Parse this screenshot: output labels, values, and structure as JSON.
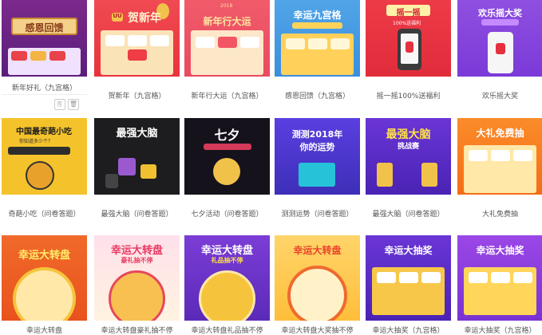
{
  "templates": [
    {
      "caption": "新年好礼（九宫格）",
      "headline": "感恩回馈"
    },
    {
      "caption": "贺新年（九宫格）",
      "headline": "贺新年",
      "badge": "UU"
    },
    {
      "caption": "新年行大运（九宫格）",
      "headline": "新年行大运",
      "tag": "2018"
    },
    {
      "caption": "感恩回馈（九宫格）",
      "headline": "幸运九宫格"
    },
    {
      "caption": "摇一摇100%送福利",
      "headline": "摇一摇",
      "subhead": "100%送福利"
    },
    {
      "caption": "欢乐摇大奖",
      "headline": "欢乐摇大奖"
    },
    {
      "caption": "奇葩小吃（问卷答题）",
      "headline": "中国最奇葩小吃",
      "subhead": "你知道多少个？"
    },
    {
      "caption": "最强大脑（问卷答题）",
      "headline": "最强大脑"
    },
    {
      "caption": "七夕活动（问卷答题）",
      "headline": "七夕"
    },
    {
      "caption": "测测运势（问卷答题）",
      "headline": "测测2018年",
      "subhead": "你的运势"
    },
    {
      "caption": "最强大脑（问卷答题）",
      "headline": "最强大脑",
      "subhead": "挑战赛"
    },
    {
      "caption": "大礼免费抽",
      "headline": "大礼免费抽"
    },
    {
      "caption": "幸运大转盘",
      "headline": "幸运大转盘"
    },
    {
      "caption": "幸运大转盘豪礼抽不停",
      "headline": "幸运大转盘",
      "subhead": "豪礼抽不停"
    },
    {
      "caption": "幸运大转盘礼品抽不停",
      "headline": "幸运大转盘",
      "subhead": "礼品抽不停"
    },
    {
      "caption": "幸运大转盘大奖抽不停",
      "headline": "幸运大转盘"
    },
    {
      "caption": "幸运大抽奖（九宫格）",
      "headline": "幸运大抽奖"
    },
    {
      "caption": "幸运大抽奖（九宫格）",
      "headline": "幸运大抽奖"
    }
  ],
  "actions": {
    "copy_icon": "⎘",
    "delete_icon": "🗑"
  }
}
